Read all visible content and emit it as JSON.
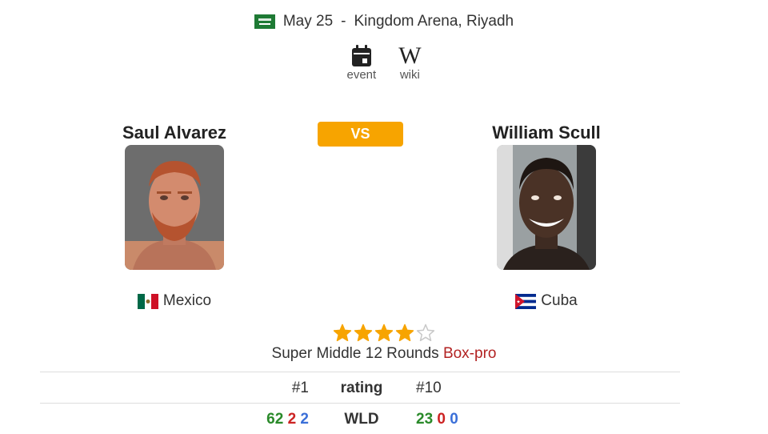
{
  "event": {
    "date": "May 25",
    "separator": "-",
    "venue": "Kingdom Arena, Riyadh",
    "flag_icon": "saudi-arabia-flag-icon"
  },
  "links": {
    "event_label": "event",
    "wiki_label": "wiki",
    "wiki_glyph": "W"
  },
  "fighter_left": {
    "name": "Saul Alvarez",
    "country": "Mexico",
    "rank": "#1",
    "record": {
      "wins": "62",
      "losses": "2",
      "draws": "2"
    }
  },
  "fighter_right": {
    "name": "William Scull",
    "country": "Cuba",
    "rank": "#10",
    "record": {
      "wins": "23",
      "losses": "0",
      "draws": "0"
    }
  },
  "vs_label": "VS",
  "rating_stars": {
    "filled": 4,
    "total": 5,
    "color": "#f7a400"
  },
  "bout": {
    "division": "Super Middle",
    "rounds": "12 Rounds",
    "type": "Box-pro"
  },
  "table": {
    "rating_label": "rating",
    "wld_label": "WLD"
  },
  "colors": {
    "accent": "#f7a400",
    "win": "#2a8a2a",
    "loss": "#cc2222",
    "draw": "#3a6fd8",
    "type": "#b22222"
  }
}
